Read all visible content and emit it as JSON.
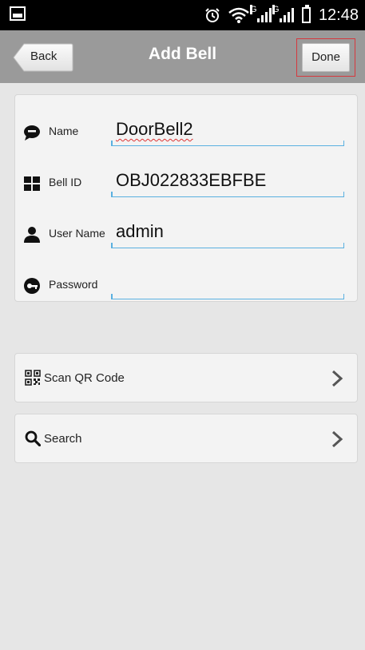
{
  "status_bar": {
    "time": "12:48",
    "icons": [
      "gallery-icon",
      "alarm-icon",
      "wifi-icon",
      "signal-icon",
      "signal-icon",
      "battery-icon"
    ],
    "network_label_1": "G",
    "network_label_2": "G"
  },
  "nav": {
    "back_label": "Back",
    "title": "Add Bell",
    "done_label": "Done"
  },
  "form": {
    "name": {
      "label": "Name",
      "value": "DoorBell2",
      "icon": "chat-bubble-icon"
    },
    "bell_id": {
      "label": "Bell ID",
      "value": "OBJ022833EBFBE",
      "icon": "grid-icon"
    },
    "user_name": {
      "label": "User Name",
      "value": "admin",
      "icon": "person-icon"
    },
    "password": {
      "label": "Password",
      "value": "",
      "icon": "key-icon"
    }
  },
  "actions": {
    "scan_qr": {
      "label": "Scan QR Code",
      "icon": "qr-code-icon"
    },
    "search": {
      "label": "Search",
      "icon": "search-icon"
    }
  },
  "colors": {
    "navbar": "#9a9a9a",
    "highlight_border": "#d6393e",
    "field_underline": "#5ab0e0",
    "background": "#e6e6e6"
  }
}
